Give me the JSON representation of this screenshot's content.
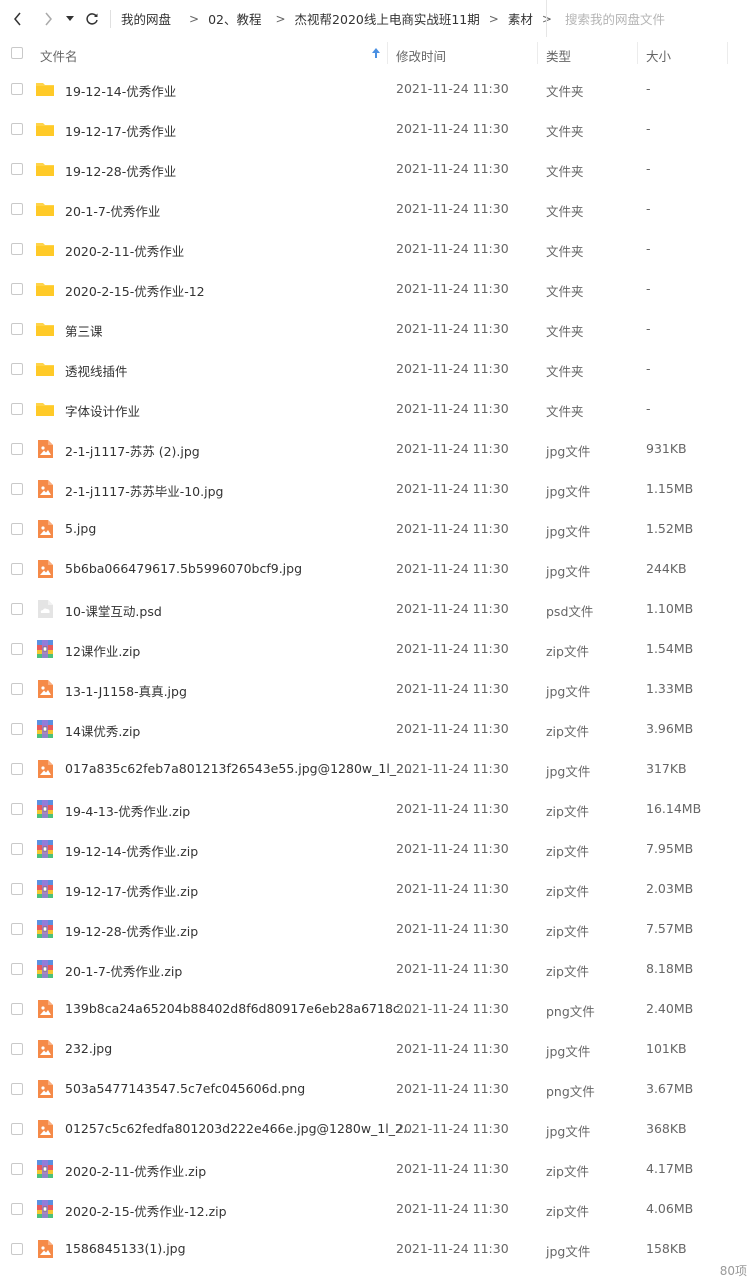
{
  "toolbar": {
    "breadcrumb": [
      "我的网盘",
      "02、教程",
      "杰视帮2020线上电商实战班11期",
      "素材"
    ],
    "search_placeholder": "搜索我的网盘文件"
  },
  "header": {
    "name": "文件名",
    "modified": "修改时间",
    "type": "类型",
    "size": "大小"
  },
  "files": [
    {
      "icon": "folder-icon",
      "name": "19-12-14-优秀作业",
      "time": "2021-11-24 11:30",
      "type": "文件夹",
      "size": "-"
    },
    {
      "icon": "folder-icon",
      "name": "19-12-17-优秀作业",
      "time": "2021-11-24 11:30",
      "type": "文件夹",
      "size": "-"
    },
    {
      "icon": "folder-icon",
      "name": "19-12-28-优秀作业",
      "time": "2021-11-24 11:30",
      "type": "文件夹",
      "size": "-"
    },
    {
      "icon": "folder-icon",
      "name": "20-1-7-优秀作业",
      "time": "2021-11-24 11:30",
      "type": "文件夹",
      "size": "-"
    },
    {
      "icon": "folder-icon",
      "name": "2020-2-11-优秀作业",
      "time": "2021-11-24 11:30",
      "type": "文件夹",
      "size": "-"
    },
    {
      "icon": "folder-icon",
      "name": "2020-2-15-优秀作业-12",
      "time": "2021-11-24 11:30",
      "type": "文件夹",
      "size": "-"
    },
    {
      "icon": "folder-icon",
      "name": "第三课",
      "time": "2021-11-24 11:30",
      "type": "文件夹",
      "size": "-"
    },
    {
      "icon": "folder-icon",
      "name": "透视线插件",
      "time": "2021-11-24 11:30",
      "type": "文件夹",
      "size": "-"
    },
    {
      "icon": "folder-icon",
      "name": "字体设计作业",
      "time": "2021-11-24 11:30",
      "type": "文件夹",
      "size": "-"
    },
    {
      "icon": "image-file-icon",
      "name": "2-1-j1117-苏苏 (2).jpg",
      "time": "2021-11-24 11:30",
      "type": "jpg文件",
      "size": "931KB"
    },
    {
      "icon": "image-file-icon",
      "name": "2-1-j1117-苏苏毕业-10.jpg",
      "time": "2021-11-24 11:30",
      "type": "jpg文件",
      "size": "1.15MB"
    },
    {
      "icon": "image-file-icon",
      "name": "5.jpg",
      "time": "2021-11-24 11:30",
      "type": "jpg文件",
      "size": "1.52MB"
    },
    {
      "icon": "image-file-icon",
      "name": "5b6ba066479617.5b5996070bcf9.jpg",
      "time": "2021-11-24 11:30",
      "type": "jpg文件",
      "size": "244KB"
    },
    {
      "icon": "cloud-file-icon",
      "name": "10-课堂互动.psd",
      "time": "2021-11-24 11:30",
      "type": "psd文件",
      "size": "1.10MB"
    },
    {
      "icon": "zip-file-icon",
      "name": "12课作业.zip",
      "time": "2021-11-24 11:30",
      "type": "zip文件",
      "size": "1.54MB"
    },
    {
      "icon": "image-file-icon",
      "name": "13-1-J1158-真真.jpg",
      "time": "2021-11-24 11:30",
      "type": "jpg文件",
      "size": "1.33MB"
    },
    {
      "icon": "zip-file-icon",
      "name": "14课优秀.zip",
      "time": "2021-11-24 11:30",
      "type": "zip文件",
      "size": "3.96MB"
    },
    {
      "icon": "image-file-icon",
      "name": "017a835c62feb7a801213f26543e55.jpg@1280w_1l_2...",
      "time": "2021-11-24 11:30",
      "type": "jpg文件",
      "size": "317KB"
    },
    {
      "icon": "zip-file-icon",
      "name": "19-4-13-优秀作业.zip",
      "time": "2021-11-24 11:30",
      "type": "zip文件",
      "size": "16.14MB"
    },
    {
      "icon": "zip-file-icon",
      "name": "19-12-14-优秀作业.zip",
      "time": "2021-11-24 11:30",
      "type": "zip文件",
      "size": "7.95MB"
    },
    {
      "icon": "zip-file-icon",
      "name": "19-12-17-优秀作业.zip",
      "time": "2021-11-24 11:30",
      "type": "zip文件",
      "size": "2.03MB"
    },
    {
      "icon": "zip-file-icon",
      "name": "19-12-28-优秀作业.zip",
      "time": "2021-11-24 11:30",
      "type": "zip文件",
      "size": "7.57MB"
    },
    {
      "icon": "zip-file-icon",
      "name": "20-1-7-优秀作业.zip",
      "time": "2021-11-24 11:30",
      "type": "zip文件",
      "size": "8.18MB"
    },
    {
      "icon": "image-file-icon",
      "name": "139b8ca24a65204b88402d8f6d80917e6eb28a6718c...",
      "time": "2021-11-24 11:30",
      "type": "png文件",
      "size": "2.40MB"
    },
    {
      "icon": "image-file-icon",
      "name": "232.jpg",
      "time": "2021-11-24 11:30",
      "type": "jpg文件",
      "size": "101KB"
    },
    {
      "icon": "image-file-icon",
      "name": "503a5477143547.5c7efc045606d.png",
      "time": "2021-11-24 11:30",
      "type": "png文件",
      "size": "3.67MB"
    },
    {
      "icon": "image-file-icon",
      "name": "01257c5c62fedfa801203d222e466e.jpg@1280w_1l_2...",
      "time": "2021-11-24 11:30",
      "type": "jpg文件",
      "size": "368KB"
    },
    {
      "icon": "zip-file-icon",
      "name": "2020-2-11-优秀作业.zip",
      "time": "2021-11-24 11:30",
      "type": "zip文件",
      "size": "4.17MB"
    },
    {
      "icon": "zip-file-icon",
      "name": "2020-2-15-优秀作业-12.zip",
      "time": "2021-11-24 11:30",
      "type": "zip文件",
      "size": "4.06MB"
    },
    {
      "icon": "image-file-icon",
      "name": "1586845133(1).jpg",
      "time": "2021-11-24 11:30",
      "type": "jpg文件",
      "size": "158KB"
    }
  ],
  "footer": {
    "count": "80项"
  },
  "colors": {
    "folder": "#ffd44a",
    "image_file": "#f58a48",
    "sort_arrow": "#4a90e2"
  }
}
